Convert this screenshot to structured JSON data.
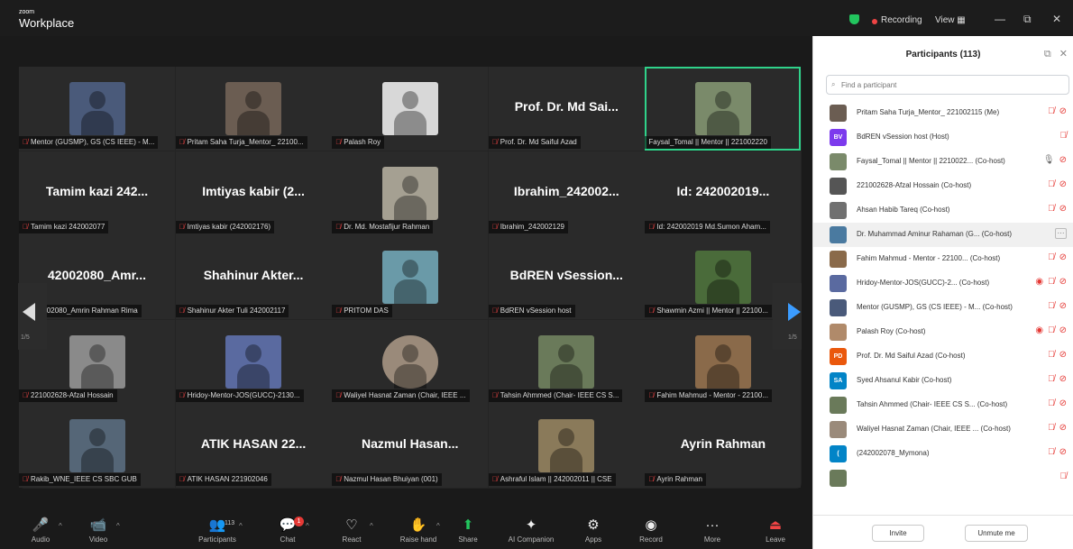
{
  "app": {
    "brand_small": "zoom",
    "brand_big": "Workplace"
  },
  "titlebar": {
    "recording": "Recording",
    "view": "View",
    "view_icon": "grid-icon",
    "minimize": "—",
    "restore": "⧉",
    "close": "✕"
  },
  "colors": {
    "accent_green": "#2fd28a",
    "mute_red": "#ef4444",
    "record_red": "#ef4444",
    "panel_bg": "#ffffff",
    "stage_bg": "#1a1a1a"
  },
  "tiles": [
    {
      "caption": "Mentor (GUSMP), GS (CS IEEE) - M...",
      "photo": "#4a5a7a"
    },
    {
      "caption": "Pritam Saha Turja_Mentor_ 22100...",
      "photo": "#6b5d52"
    },
    {
      "caption": "Palash Roy",
      "photo": "#d8d8d8"
    },
    {
      "name": "Prof. Dr. Md Sai...",
      "caption": "Prof. Dr. Md Saiful Azad"
    },
    {
      "caption": "Faysal_Tomal || Mentor || 221002220",
      "photo": "#7a8a6a"
    },
    {
      "name": "Tamim kazi 242...",
      "caption": "Tamim kazi 242002077"
    },
    {
      "name": "Imtiyas kabir (2...",
      "caption": "Imtiyas kabir (242002176)"
    },
    {
      "caption": "Dr. Md. Mostafijur Rahman",
      "photo": "#a5a092"
    },
    {
      "name": "Ibrahim_242002...",
      "caption": "Ibrahim_242002129"
    },
    {
      "name": "Id: 242002019...",
      "caption": "Id: 242002019 Md.Sumon Aham..."
    },
    {
      "name": "42002080_Amr...",
      "caption": "242002080_Amrin Rahman Rima"
    },
    {
      "name": "Shahinur Akter...",
      "caption": "Shahinur Akter Tuli 242002117"
    },
    {
      "caption": "PRITOM DAS",
      "photo": "#6a9aa8"
    },
    {
      "name": "BdREN vSession...",
      "caption": "BdREN vSession host"
    },
    {
      "caption": "Shawmin Azmi || Mentor || 22100...",
      "photo": "#4a6b3a"
    },
    {
      "caption": "221002628-Afzal Hossain",
      "photo": "#8a8a8a"
    },
    {
      "caption": "Hridoy-Mentor-JOS(GUCC)-2130...",
      "photo": "#5a6aa0"
    },
    {
      "caption": "Waliyel Hasnat Zaman (Chair, IEEE ...",
      "photo": "#9a8a7a"
    },
    {
      "caption": "Tahsin Ahmmed (Chair- IEEE CS S...",
      "photo": "#6a7a5a"
    },
    {
      "caption": "Fahim Mahmud - Mentor - 22100...",
      "photo": "#8a6a4a"
    },
    {
      "caption": "Rakib_WNE_IEEE CS SBC GUB",
      "photo": "#556677"
    },
    {
      "name": "ATIK HASAN 22...",
      "caption": "ATIK HASAN 221902046"
    },
    {
      "name": "Nazmul Hasan...",
      "caption": "Nazmul Hasan Bhuiyan (001)"
    },
    {
      "caption": "Ashraful Islam || 242002011 || CSE",
      "photo": "#8a7a5a"
    },
    {
      "name": "Ayrin Rahman",
      "caption": "Ayrin Rahman"
    }
  ],
  "pager": {
    "page": "1/5"
  },
  "toolbar": [
    {
      "label": "Audio",
      "icon": "🎤"
    },
    {
      "label": "Video",
      "icon": "📹"
    },
    {
      "label": "Participants",
      "icon": "👥",
      "count": "113"
    },
    {
      "label": "Chat",
      "icon": "💬",
      "badge": "1"
    },
    {
      "label": "React",
      "icon": "♡"
    },
    {
      "label": "Raise hand",
      "icon": "✋"
    },
    {
      "label": "Share",
      "icon": "⬆"
    },
    {
      "label": "AI Companion",
      "icon": "✦"
    },
    {
      "label": "Apps",
      "icon": "⚙"
    },
    {
      "label": "Record",
      "icon": "◉"
    },
    {
      "label": "More",
      "icon": "···"
    },
    {
      "label": "Leave",
      "icon": "⏏"
    }
  ],
  "panel": {
    "title": "Participants (113)",
    "search_placeholder": "Find a participant",
    "invite": "Invite",
    "unmute_me": "Unmute me",
    "participants": [
      {
        "name": "Pritam Saha Turja_Mentor_ 221002115 (Me)",
        "avatar": "#6b5d52",
        "icons": "mic-off video-off"
      },
      {
        "name": "BdREN vSession host (Host)",
        "initials": "BV",
        "avatar": "#7c3aed",
        "icons": "mic-off"
      },
      {
        "name": "Faysal_Tomal || Mentor || 2210022... (Co-host)",
        "avatar": "#7a8a6a",
        "icons": "mic video-off"
      },
      {
        "name": "221002628-Afzal Hossain (Co-host)",
        "avatar": "#555555",
        "icons": "mic-off video-off"
      },
      {
        "name": "Ahsan Habib Tareq (Co-host)",
        "avatar": "#707070",
        "icons": "mic-off video-off"
      },
      {
        "name": "Dr. Muhammad Aminur Rahaman (G...  (Co-host)",
        "avatar": "#4a7aa0",
        "icons": "more",
        "highlight": true
      },
      {
        "name": "Fahim Mahmud - Mentor - 22100...  (Co-host)",
        "avatar": "#8a6a4a",
        "icons": "mic-off video-off"
      },
      {
        "name": "Hridoy-Mentor-JOS(GUCC)-2...  (Co-host)",
        "avatar": "#5a6aa0",
        "icons": "rec mic-off video-off"
      },
      {
        "name": "Mentor (GUSMP), GS (CS IEEE) - M...  (Co-host)",
        "avatar": "#4a5a7a",
        "icons": "mic-off video-off"
      },
      {
        "name": "Palash Roy (Co-host)",
        "avatar": "#b08a6a",
        "icons": "rec mic-off video-off"
      },
      {
        "name": "Prof. Dr. Md Saiful Azad (Co-host)",
        "initials": "PD",
        "avatar": "#ea580c",
        "icons": "mic-off video-off"
      },
      {
        "name": "Syed Ahsanul Kabir (Co-host)",
        "initials": "SA",
        "avatar": "#0284c7",
        "icons": "mic-off video-off"
      },
      {
        "name": "Tahsin Ahmmed (Chair- IEEE CS S...  (Co-host)",
        "avatar": "#6a7a5a",
        "icons": "mic-off video-off"
      },
      {
        "name": "Waliyel Hasnat Zaman (Chair, IEEE ...  (Co-host)",
        "avatar": "#9a8a7a",
        "icons": "mic-off video-off"
      },
      {
        "name": "(242002078_Mymona)",
        "initials": "(",
        "avatar": "#0284c7",
        "icons": "mic-off video-off"
      },
      {
        "name": "",
        "avatar": "#6a7a5a",
        "icons": "mic-off"
      }
    ]
  }
}
